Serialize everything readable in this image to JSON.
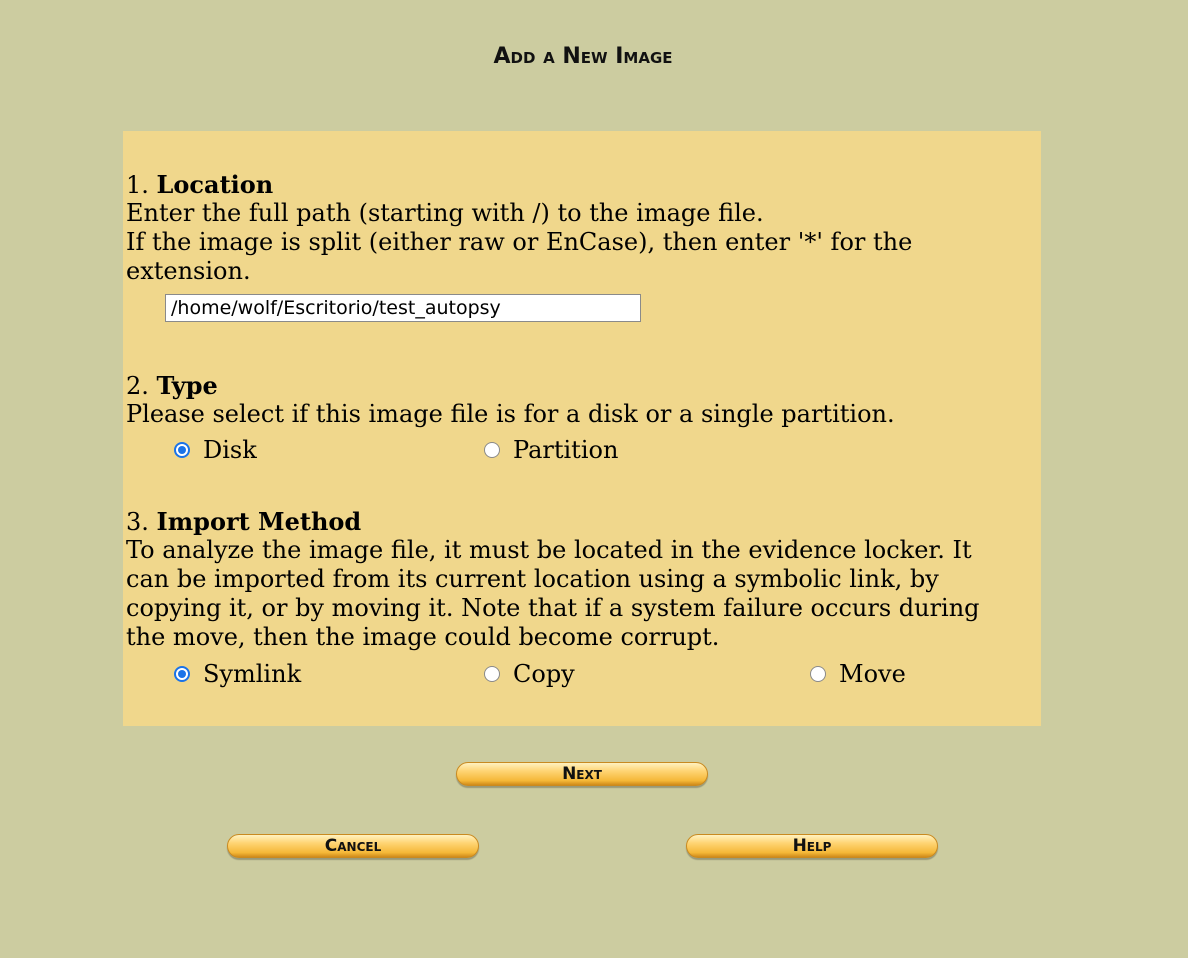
{
  "title": "Add a New Image",
  "location": {
    "number": "1.",
    "heading": "Location",
    "line1": "Enter the full path (starting with /) to the image file.",
    "line2": "If the image is split (either raw or EnCase), then enter '*' for the extension.",
    "path_value": "/home/wolf/Escritorio/test_autopsy"
  },
  "type": {
    "number": "2.",
    "heading": "Type",
    "desc": "Please select if this image file is for a disk or a single partition.",
    "options": [
      {
        "label": "Disk",
        "checked": true
      },
      {
        "label": "Partition",
        "checked": false
      }
    ]
  },
  "import": {
    "number": "3.",
    "heading": "Import Method",
    "desc": "To analyze the image file, it must be located in the evidence locker. It can be imported from its current location using a symbolic link, by copying it, or by moving it. Note that if a system failure occurs during the move, then the image could become corrupt.",
    "options": [
      {
        "label": "Symlink",
        "checked": true
      },
      {
        "label": "Copy",
        "checked": false
      },
      {
        "label": "Move",
        "checked": false
      }
    ]
  },
  "buttons": {
    "next": "Next",
    "cancel": "Cancel",
    "help": "Help"
  },
  "colors": {
    "background": "#cccca0",
    "panel": "#f0d78c",
    "radio_checked": "#1a73e8"
  }
}
